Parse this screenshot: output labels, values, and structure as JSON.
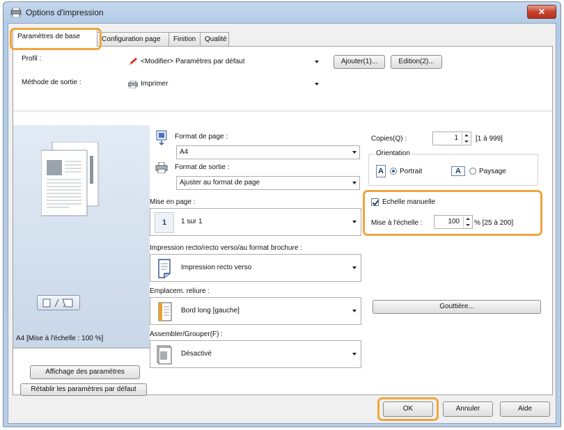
{
  "window": {
    "title": "Options d'impression",
    "close_label": "✕"
  },
  "tabs": [
    {
      "label": "Paramètres de base"
    },
    {
      "label": "Configuration page"
    },
    {
      "label": "Finition"
    },
    {
      "label": "Qualité"
    }
  ],
  "profile": {
    "label": "Profil :",
    "value": "<Modifier> Paramètres par défaut",
    "add_button": "Ajouter(1)...",
    "edit_button": "Edition(2)..."
  },
  "output_method": {
    "label": "Méthode de sortie :",
    "value": "Imprimer"
  },
  "page_size": {
    "label": "Format de page :",
    "value": "A4"
  },
  "output_size": {
    "label": "Format de sortie :",
    "value": "Ajuster au format de page"
  },
  "page_layout": {
    "label": "Mise en page :",
    "value": "1 sur 1",
    "icon_number": "1"
  },
  "duplex": {
    "label": "Impression recto/recto verso/au format brochure :",
    "value": "Impression recto verso"
  },
  "binding": {
    "label": "Emplacem. reliure :",
    "value": "Bord long [gauche]"
  },
  "collate": {
    "label": "Assembler/Grouper(F) :",
    "value": "Désactivé"
  },
  "copies": {
    "label": "Copies(Q) :",
    "value": "1",
    "range": "[1 à 999]"
  },
  "orientation": {
    "label": "Orientation",
    "portrait": "Portrait",
    "landscape": "Paysage",
    "letter": "A"
  },
  "scaling": {
    "checkbox_label": "Echelle manuelle",
    "label": "Mise à l'échelle :",
    "value": "100",
    "range": "% [25 à 200]"
  },
  "gutter_button": "Gouttière...",
  "preview": {
    "caption": "A4 [Mise à l'échelle : 100 %]",
    "show_settings_button": "Affichage des paramètres",
    "restore_defaults_button": "Rétablir les paramètres par défaut"
  },
  "footer": {
    "ok": "OK",
    "cancel": "Annuler",
    "help": "Aide"
  },
  "colors": {
    "highlight": "#f0a53c",
    "accent": "#1c5fb8"
  }
}
